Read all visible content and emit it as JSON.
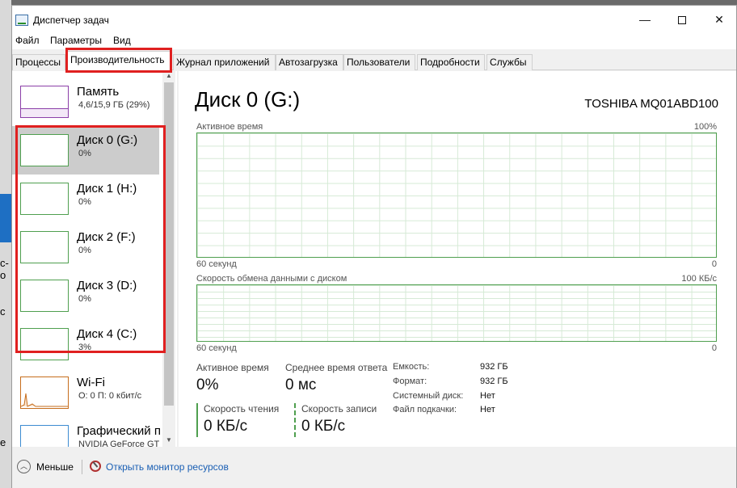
{
  "window": {
    "title": "Диспетчер задач",
    "min": "—",
    "close": "✕"
  },
  "menu": [
    "Файл",
    "Параметры",
    "Вид"
  ],
  "tabs": [
    "Процессы",
    "Производительность",
    "Журнал приложений",
    "Автозагрузка",
    "Пользователи",
    "Подробности",
    "Службы"
  ],
  "active_tab": "Производительность",
  "sidebar": {
    "items": [
      {
        "name": "Память",
        "sub": "4,6/15,9 ГБ (29%)",
        "fill_percent": 29,
        "color": "#8b3fa8"
      },
      {
        "name": "Диск 0 (G:)",
        "sub": "0%",
        "selected": true,
        "color": "#4f9f4f"
      },
      {
        "name": "Диск 1 (H:)",
        "sub": "0%",
        "color": "#4f9f4f"
      },
      {
        "name": "Диск 2 (F:)",
        "sub": "0%",
        "color": "#4f9f4f"
      },
      {
        "name": "Диск 3 (D:)",
        "sub": "0%",
        "color": "#4f9f4f"
      },
      {
        "name": "Диск 4 (C:)",
        "sub": "3%",
        "color": "#4f9f4f"
      },
      {
        "name": "Wi-Fi",
        "sub": "О: 0 П: 0 кбит/с",
        "color": "#c66d1c"
      },
      {
        "name": "Графический п",
        "sub": "NVIDIA GeForce GT",
        "color": "#3d8cd1"
      }
    ]
  },
  "main": {
    "title": "Диск 0 (G:)",
    "model": "TOSHIBA MQ01ABD100",
    "graph1": {
      "label": "Активное время",
      "max": "100%",
      "time": "60 секунд",
      "min": "0"
    },
    "graph2": {
      "label": "Скорость обмена данными с диском",
      "max": "100 КБ/с",
      "time": "60 секунд",
      "min": "0"
    },
    "stats": {
      "active_time_label": "Активное время",
      "active_time_value": "0%",
      "avg_response_label": "Среднее время ответа",
      "avg_response_value": "0 мс",
      "read_label": "Скорость чтения",
      "read_value": "0 КБ/с",
      "write_label": "Скорость записи",
      "write_value": "0 КБ/с"
    },
    "props": [
      {
        "key": "Емкость:",
        "value": "932 ГБ"
      },
      {
        "key": "Формат:",
        "value": "932 ГБ"
      },
      {
        "key": "Системный диск:",
        "value": "Нет"
      },
      {
        "key": "Файл подкачки:",
        "value": "Нет"
      }
    ]
  },
  "footer": {
    "less": "Меньше",
    "monitor_link": "Открыть монитор ресурсов"
  },
  "background": {
    "t1": "с-о",
    "t2": "с",
    "t3": "е"
  }
}
